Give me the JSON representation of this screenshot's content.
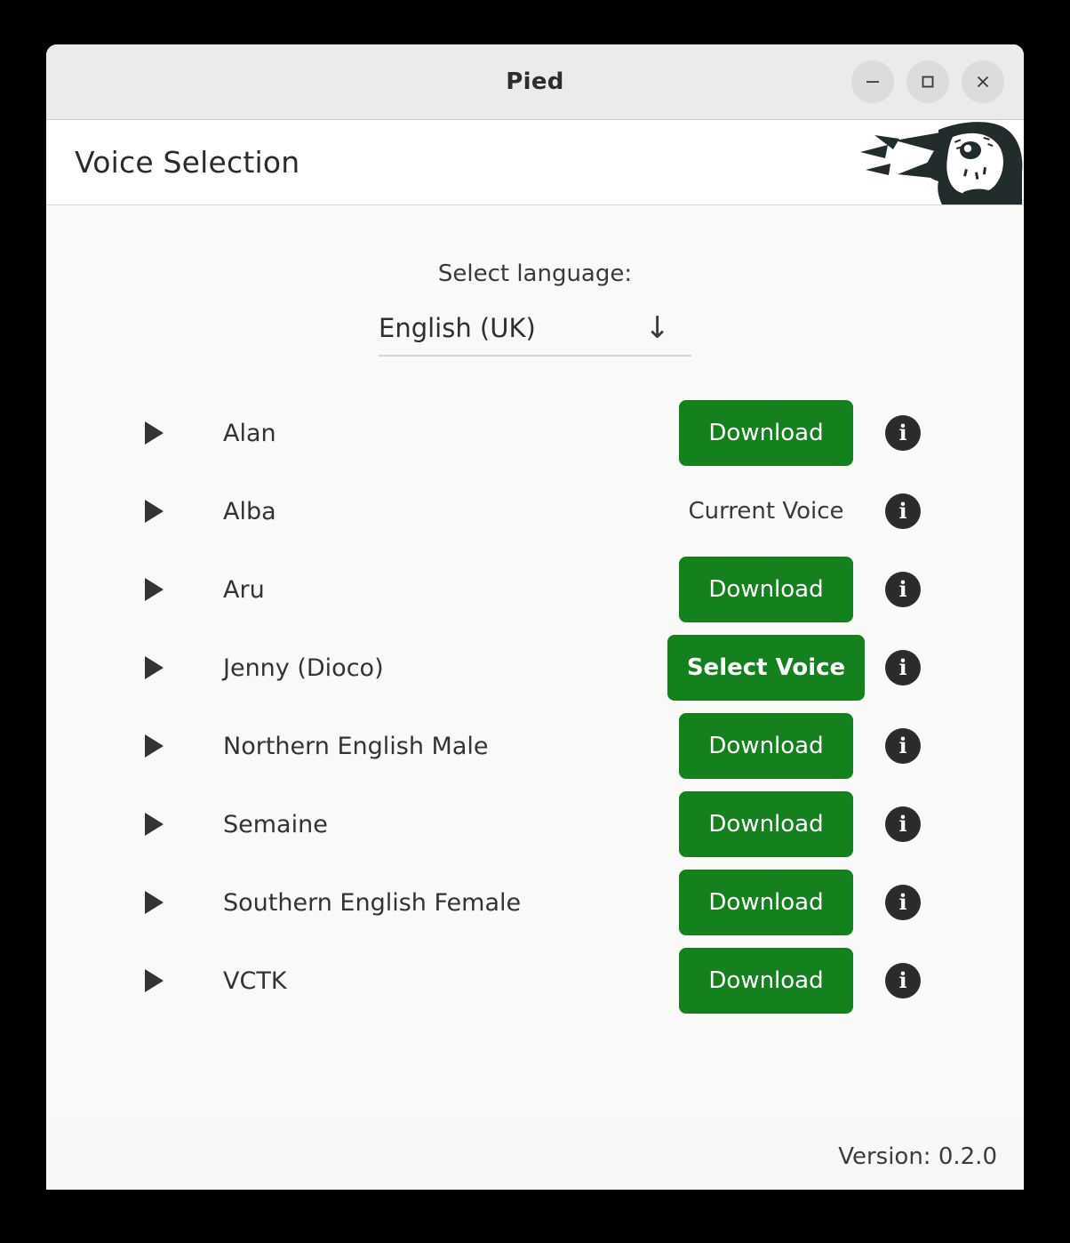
{
  "window": {
    "title": "Pied",
    "controls": [
      {
        "name": "minimize",
        "glyph": "minimize-icon"
      },
      {
        "name": "maximize",
        "glyph": "maximize-icon"
      },
      {
        "name": "close",
        "glyph": "close-icon"
      }
    ]
  },
  "header": {
    "page_title": "Voice Selection",
    "logo": "pied-bird-logo"
  },
  "language": {
    "label": "Select language:",
    "selected": "English (UK)",
    "arrow": "↓"
  },
  "voices": [
    {
      "name": "Alan",
      "action": "Download",
      "type": "button",
      "bold": false,
      "info": "i"
    },
    {
      "name": "Alba",
      "action": "Current Voice",
      "type": "text",
      "bold": false,
      "info": "i"
    },
    {
      "name": "Aru",
      "action": "Download",
      "type": "button",
      "bold": false,
      "info": "i"
    },
    {
      "name": "Jenny (Dioco)",
      "action": "Select Voice",
      "type": "button",
      "bold": true,
      "info": "i"
    },
    {
      "name": "Northern English Male",
      "action": "Download",
      "type": "button",
      "bold": false,
      "info": "i"
    },
    {
      "name": "Semaine",
      "action": "Download",
      "type": "button",
      "bold": false,
      "info": "i"
    },
    {
      "name": "Southern English Female",
      "action": "Download",
      "type": "button",
      "bold": false,
      "info": "i"
    },
    {
      "name": "VCTK",
      "action": "Download",
      "type": "button",
      "bold": false,
      "info": "i"
    }
  ],
  "footer": {
    "version": "Version: 0.2.0"
  },
  "colors": {
    "accent_green": "#15801e",
    "titlebar_bg": "#ebebeb",
    "content_bg": "#f9f9f8",
    "info_icon_bg": "#2b2b2b"
  }
}
